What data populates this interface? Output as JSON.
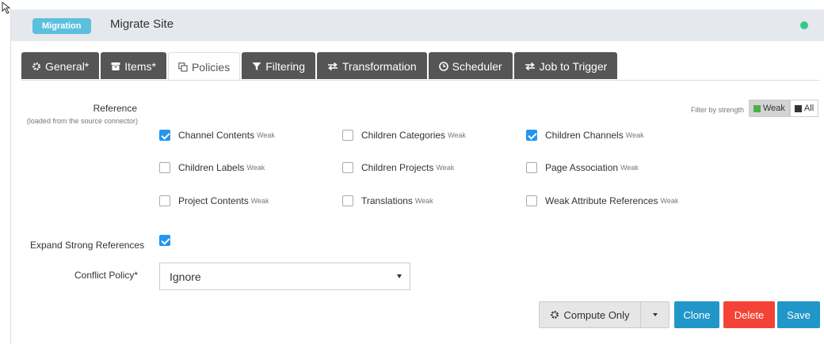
{
  "header": {
    "badge": "Migration",
    "title": "Migrate Site",
    "status_color": "#2ecc8b"
  },
  "tabs": [
    {
      "icon": "gear-icon",
      "label": "General*",
      "active": false
    },
    {
      "icon": "archive-icon",
      "label": "Items*",
      "active": false
    },
    {
      "icon": "copy-icon",
      "label": "Policies",
      "active": true
    },
    {
      "icon": "filter-icon",
      "label": "Filtering",
      "active": false
    },
    {
      "icon": "exchange-icon",
      "label": "Transformation",
      "active": false
    },
    {
      "icon": "clock-icon",
      "label": "Scheduler",
      "active": false
    },
    {
      "icon": "exchange-icon",
      "label": "Job to Trigger",
      "active": false
    }
  ],
  "reference": {
    "label": "Reference",
    "sublabel": "(loaded from the source connector)"
  },
  "filter": {
    "label": "Filter by strength",
    "weak": "Weak",
    "all": "All",
    "weak_color": "#4cae4c",
    "all_color": "#333333"
  },
  "checkboxes": [
    {
      "label": "Channel Contents",
      "tag": "Weak",
      "checked": true
    },
    {
      "label": "Children Categories",
      "tag": "Weak",
      "checked": false
    },
    {
      "label": "Children Channels",
      "tag": "Weak",
      "checked": true
    },
    {
      "label": "Children Labels",
      "tag": "Weak",
      "checked": false
    },
    {
      "label": "Children Projects",
      "tag": "Weak",
      "checked": false
    },
    {
      "label": "Page Association",
      "tag": "Weak",
      "checked": false
    },
    {
      "label": "Project Contents",
      "tag": "Weak",
      "checked": false
    },
    {
      "label": "Translations",
      "tag": "Weak",
      "checked": false
    },
    {
      "label": "Weak Attribute References",
      "tag": "Weak",
      "checked": false
    }
  ],
  "expand": {
    "label": "Expand Strong References",
    "checked": true
  },
  "conflict": {
    "label": "Conflict Policy*",
    "value": "Ignore"
  },
  "buttons": {
    "compute": "Compute Only",
    "clone": "Clone",
    "delete": "Delete",
    "save": "Save"
  },
  "colors": {
    "primary": "#2196c9",
    "danger": "#f44336",
    "tab_dark": "#555555",
    "header_bg": "#e5e8ec"
  }
}
